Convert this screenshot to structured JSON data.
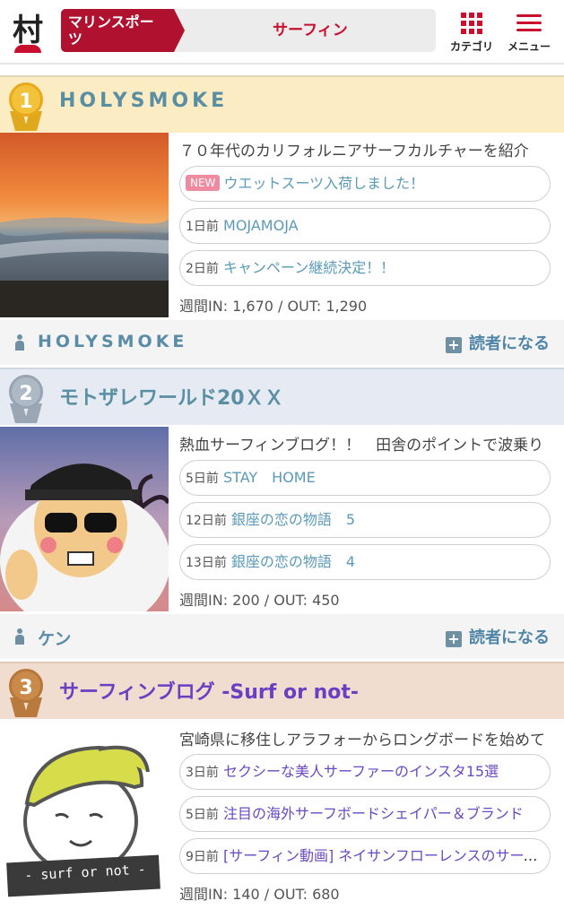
{
  "header": {
    "logo_char": "村",
    "category": "マリンスポーツ",
    "subcategory": "サーフィン",
    "category_menu_label": "カテゴリ",
    "menu_label": "メニュー"
  },
  "colors": {
    "brand": "#c8102e",
    "link": "#5a9ab8",
    "gold": "#f7d26a",
    "silver": "#b8c3cf",
    "bronze": "#c98a4a"
  },
  "rankings": [
    {
      "rank": "1",
      "title": "HOLYSMOKE",
      "description": "７０年代のカリフォルニアサーフカルチャーを紹介",
      "entries": [
        {
          "badge": "NEW",
          "time": "",
          "title": "ウエットスーツ入荷しました！"
        },
        {
          "badge": "",
          "time": "1日前",
          "title": "MOJAMOJA"
        },
        {
          "badge": "",
          "time": "2日前",
          "title": "キャンペーン継続決定！！"
        }
      ],
      "stats": "週間IN: 1,670  /  OUT: 1,290",
      "author": "HOLYSMOKE",
      "follow_label": "読者になる"
    },
    {
      "rank": "2",
      "title": "モトザレワールド20ＸＸ",
      "description": "熱血サーフィンブログ！！　田舎のポイントで波乗り",
      "entries": [
        {
          "badge": "",
          "time": "5日前",
          "title": "STAY　HOME"
        },
        {
          "badge": "",
          "time": "12日前",
          "title": "銀座の恋の物語　5"
        },
        {
          "badge": "",
          "time": "13日前",
          "title": "銀座の恋の物語　4"
        }
      ],
      "stats": "週間IN: 200  /  OUT: 450",
      "author": "ケン",
      "follow_label": "読者になる"
    },
    {
      "rank": "3",
      "title": "サーフィンブログ -Surf or not-",
      "description": "宮崎県に移住しアラフォーからロングボードを始めて",
      "entries": [
        {
          "badge": "",
          "time": "3日前",
          "title": "セクシーな美人サーファーのインスタ15選"
        },
        {
          "badge": "",
          "time": "5日前",
          "title": "注目の海外サーフボードシェイパー＆ブランド"
        },
        {
          "badge": "",
          "time": "9日前",
          "title": "[サーフィン動画] ネイサンフローレンスのサーフィン"
        }
      ],
      "stats": "週間IN: 140  /  OUT: 680",
      "thumb_caption": "- surf or not -"
    }
  ]
}
